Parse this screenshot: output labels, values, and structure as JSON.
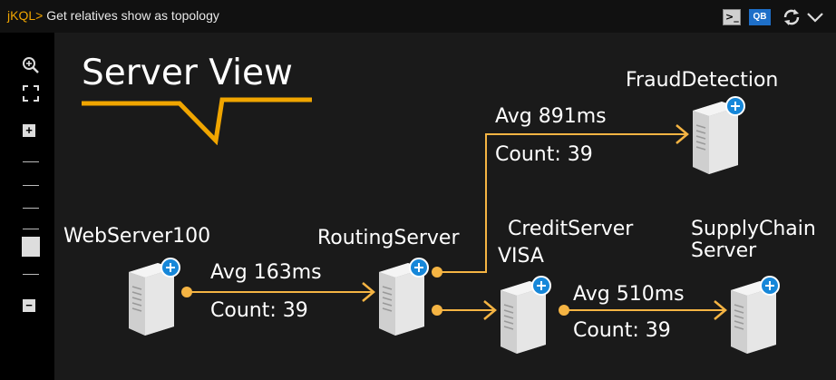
{
  "toolbar": {
    "query_prefix": "jKQL>",
    "query_text": "Get relatives show as topology",
    "terminal_icon_label": ">_",
    "qb_label": "QB",
    "icons": [
      "terminal-icon",
      "query-builder-icon",
      "refresh-icon",
      "chevron-down-icon"
    ]
  },
  "sidebar": {
    "zoom_in_label": "+",
    "zoom_out_label": "−",
    "icons": [
      "zoom-magnifier-icon",
      "fit-to-screen-icon"
    ]
  },
  "view": {
    "title": "Server View"
  },
  "nodes": [
    {
      "id": "webserver100",
      "label_lines": [
        "WebServer100"
      ]
    },
    {
      "id": "routingserver",
      "label_lines": [
        "RoutingServer"
      ]
    },
    {
      "id": "frauddetection",
      "label_lines": [
        "FraudDetection"
      ]
    },
    {
      "id": "creditserver",
      "label_lines": [
        "CreditServer",
        "VISA"
      ]
    },
    {
      "id": "supplychain",
      "label_lines": [
        "SupplyChain",
        "Server"
      ]
    }
  ],
  "edges": [
    {
      "from": "webserver100",
      "to": "routingserver",
      "avg": "Avg 163ms",
      "count": "Count: 39"
    },
    {
      "from": "routingserver",
      "to": "frauddetection",
      "avg": "Avg 891ms",
      "count": "Count: 39"
    },
    {
      "from": "routingserver",
      "to": "creditserver",
      "avg": "",
      "count": ""
    },
    {
      "from": "creditserver",
      "to": "supplychain",
      "avg": "Avg 510ms",
      "count": "Count: 39"
    }
  ],
  "colors": {
    "edge": "#f5b443",
    "accent": "#f0a500",
    "plus": "#1687d9"
  }
}
